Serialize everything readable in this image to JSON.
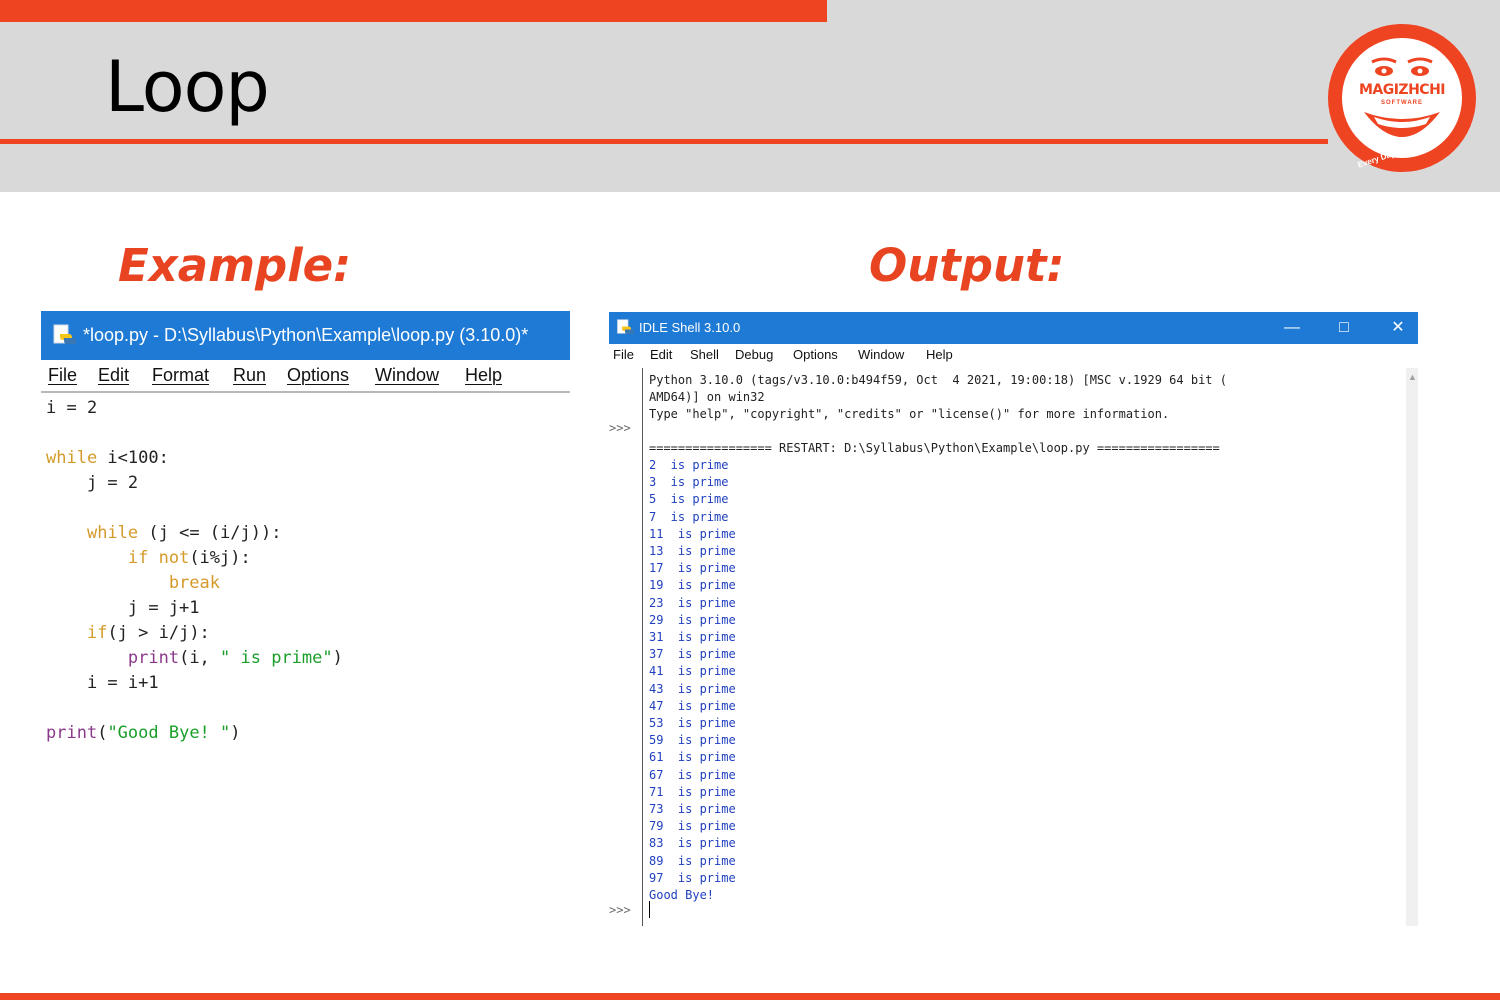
{
  "slide": {
    "title": "Loop",
    "example_label": "Example:",
    "output_label": "Output:"
  },
  "logo": {
    "brand": "MAGIZHCHI",
    "sub": "SOFTWARE",
    "tagline": "Every Day Happy Day"
  },
  "editor": {
    "title": "*loop.py - D:\\Syllabus\\Python\\Example\\loop.py (3.10.0)*",
    "menu": [
      "File",
      "Edit",
      "Format",
      "Run",
      "Options",
      "Window",
      "Help"
    ]
  },
  "shell": {
    "title": "IDLE Shell 3.10.0",
    "menu": [
      "File",
      "Edit",
      "Shell",
      "Debug",
      "Options",
      "Window",
      "Help"
    ],
    "prompt": ">>>",
    "banner": [
      "Python 3.10.0 (tags/v3.10.0:b494f59, Oct  4 2021, 19:00:18) [MSC v.1929 64 bit (",
      "AMD64)] on win32",
      "Type \"help\", \"copyright\", \"credits\" or \"license()\" for more information."
    ],
    "restart": "================= RESTART: D:\\Syllabus\\Python\\Example\\loop.py =================",
    "output": [
      "2  is prime",
      "3  is prime",
      "5  is prime",
      "7  is prime",
      "11  is prime",
      "13  is prime",
      "17  is prime",
      "19  is prime",
      "23  is prime",
      "29  is prime",
      "31  is prime",
      "37  is prime",
      "41  is prime",
      "43  is prime",
      "47  is prime",
      "53  is prime",
      "59  is prime",
      "61  is prime",
      "67  is prime",
      "71  is prime",
      "73  is prime",
      "79  is prime",
      "83  is prime",
      "89  is prime",
      "97  is prime",
      "Good Bye!"
    ]
  },
  "colors": {
    "accent": "#ee4422",
    "header_band": "#d9d9d9",
    "titlebar": "#1e7ad4",
    "keyword": "#d49a2a",
    "builtin": "#8b3a8b",
    "string": "#1a9e2a",
    "shell_output": "#1f3fbf"
  }
}
